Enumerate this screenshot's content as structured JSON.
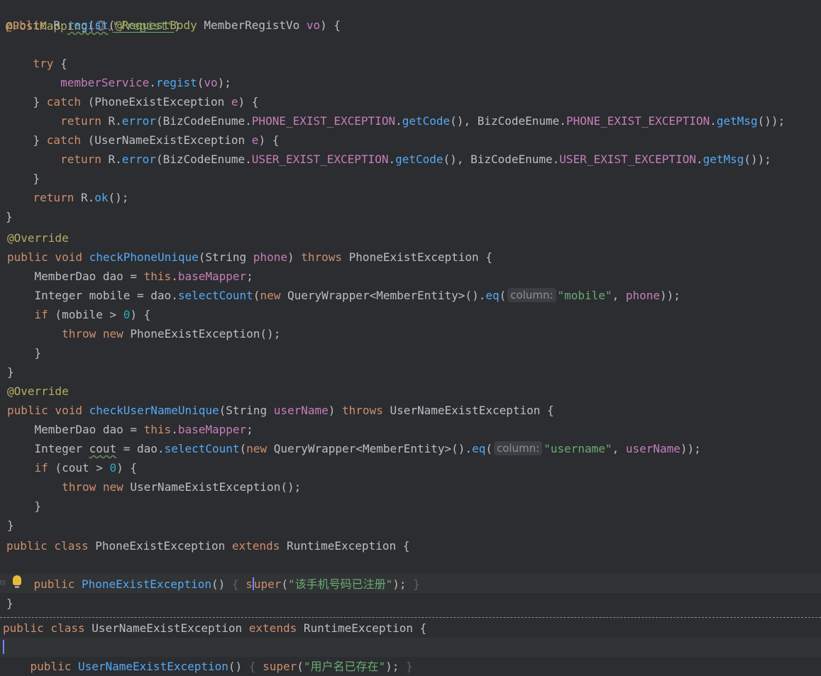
{
  "editor": {
    "hints": {
      "column": "column:"
    },
    "strings": {
      "regist_path": "\"/regist\"",
      "mobile": "\"mobile\"",
      "username": "\"username\"",
      "phone_msg": "\"该手机号码已注册\"",
      "user_msg": "\"用户名已存在\""
    },
    "numbers": {
      "zero": "0"
    }
  }
}
